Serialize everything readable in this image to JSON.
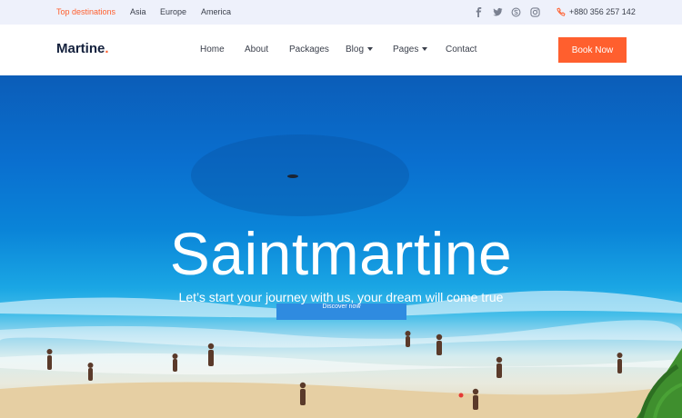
{
  "topbar": {
    "links": [
      "Top destinations",
      "Asia",
      "Europe",
      "America"
    ],
    "social": [
      "facebook-icon",
      "twitter-icon",
      "skype-icon",
      "instagram-icon"
    ],
    "phone": "+880 356 257 142"
  },
  "header": {
    "logo": "Martine",
    "logo_dot": ".",
    "nav": [
      "Home",
      "About",
      "Packages",
      "Blog",
      "Pages",
      "Contact"
    ],
    "book_label": "Book Now"
  },
  "hero": {
    "title": "Saintmartine",
    "subtitle": "Let’s start your journey with us, your dream will come true",
    "discover_label": "Discover now"
  },
  "colors": {
    "accent": "#ff5f2e",
    "logo": "#14213d",
    "topbar_bg": "#eef1fb",
    "button_blue": "#2f8be0"
  }
}
